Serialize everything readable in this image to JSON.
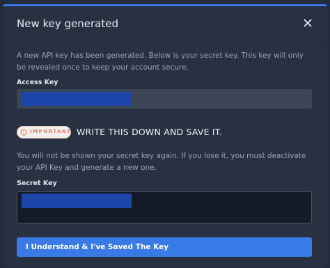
{
  "modal": {
    "title": "New key generated",
    "description": "A new API key has been generated. Below is your secret key. This key will only be revealed once to keep your account secure.",
    "access_key_label": "Access Key",
    "important_badge": "IMPORTANT",
    "important_message": "WRITE THIS DOWN AND SAVE IT.",
    "warning": "You will not be shown your secret key again. If you lose it, you must deactivate your API Key and generate a new one.",
    "secret_key_label": "Secret Key",
    "confirm_button": "I Understand & I've Saved The Key",
    "close_icon": "close-icon",
    "important_icon": "info-circle-icon"
  },
  "colors": {
    "accent": "#3a7ae6",
    "modal_bg": "#273142",
    "badge_text": "#e07c68",
    "redaction": "#1b45a9"
  }
}
